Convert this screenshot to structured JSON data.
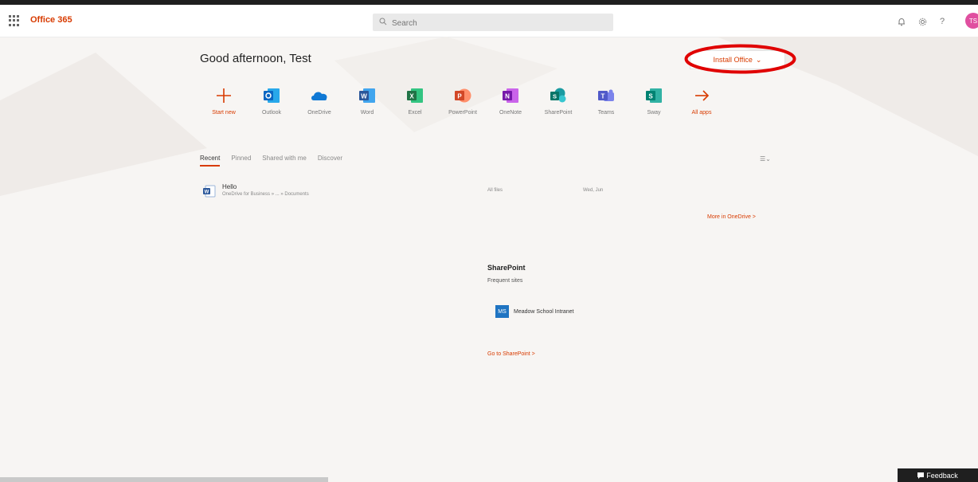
{
  "header": {
    "brand": "Office 365",
    "search_placeholder": "Search",
    "icons": [
      "bell-icon",
      "gear-icon",
      "help-icon"
    ],
    "help_glyph": "?",
    "avatar_initials": "TS"
  },
  "home": {
    "greeting": "Good afternoon, Test",
    "install_label": "Install Office",
    "install_chevron": "⌄"
  },
  "apps": [
    {
      "label": "Start new",
      "icon": "plus-icon",
      "color": "#d83b01"
    },
    {
      "label": "Outlook",
      "icon": "outlook-icon",
      "color": "#0a66c2"
    },
    {
      "label": "OneDrive",
      "icon": "onedrive-icon",
      "color": "#0f78d4"
    },
    {
      "label": "Word",
      "icon": "word-icon",
      "color": "#2b579a"
    },
    {
      "label": "Excel",
      "icon": "excel-icon",
      "color": "#217346"
    },
    {
      "label": "PowerPoint",
      "icon": "powerpoint-icon",
      "color": "#d24726"
    },
    {
      "label": "OneNote",
      "icon": "onenote-icon",
      "color": "#7719aa"
    },
    {
      "label": "SharePoint",
      "icon": "sharepoint-icon",
      "color": "#077568"
    },
    {
      "label": "Teams",
      "icon": "teams-icon",
      "color": "#5059c9"
    },
    {
      "label": "Sway",
      "icon": "sway-icon",
      "color": "#008272"
    },
    {
      "label": "All apps",
      "icon": "arrow-right-icon",
      "color": "#d83b01"
    }
  ],
  "tabs": [
    "Recent",
    "Pinned",
    "Shared with me",
    "Discover"
  ],
  "sort_label": "☰⌄",
  "recent_files": [
    {
      "name": "Hello",
      "path": "OneDrive for Business » ... » Documents",
      "activity": "All files",
      "time": "Wed, Jun"
    }
  ],
  "more_link": "More in OneDrive  >",
  "sharepoint": {
    "title": "SharePoint",
    "subtitle": "Frequent sites",
    "sites": [
      {
        "initials": "MS",
        "name": "Meadow School Intranet"
      }
    ],
    "go_link": "Go to SharePoint  >"
  },
  "feedback_label": "Feedback",
  "colors": {
    "accent": "#d83b01",
    "highlight_ring": "#e00000"
  }
}
